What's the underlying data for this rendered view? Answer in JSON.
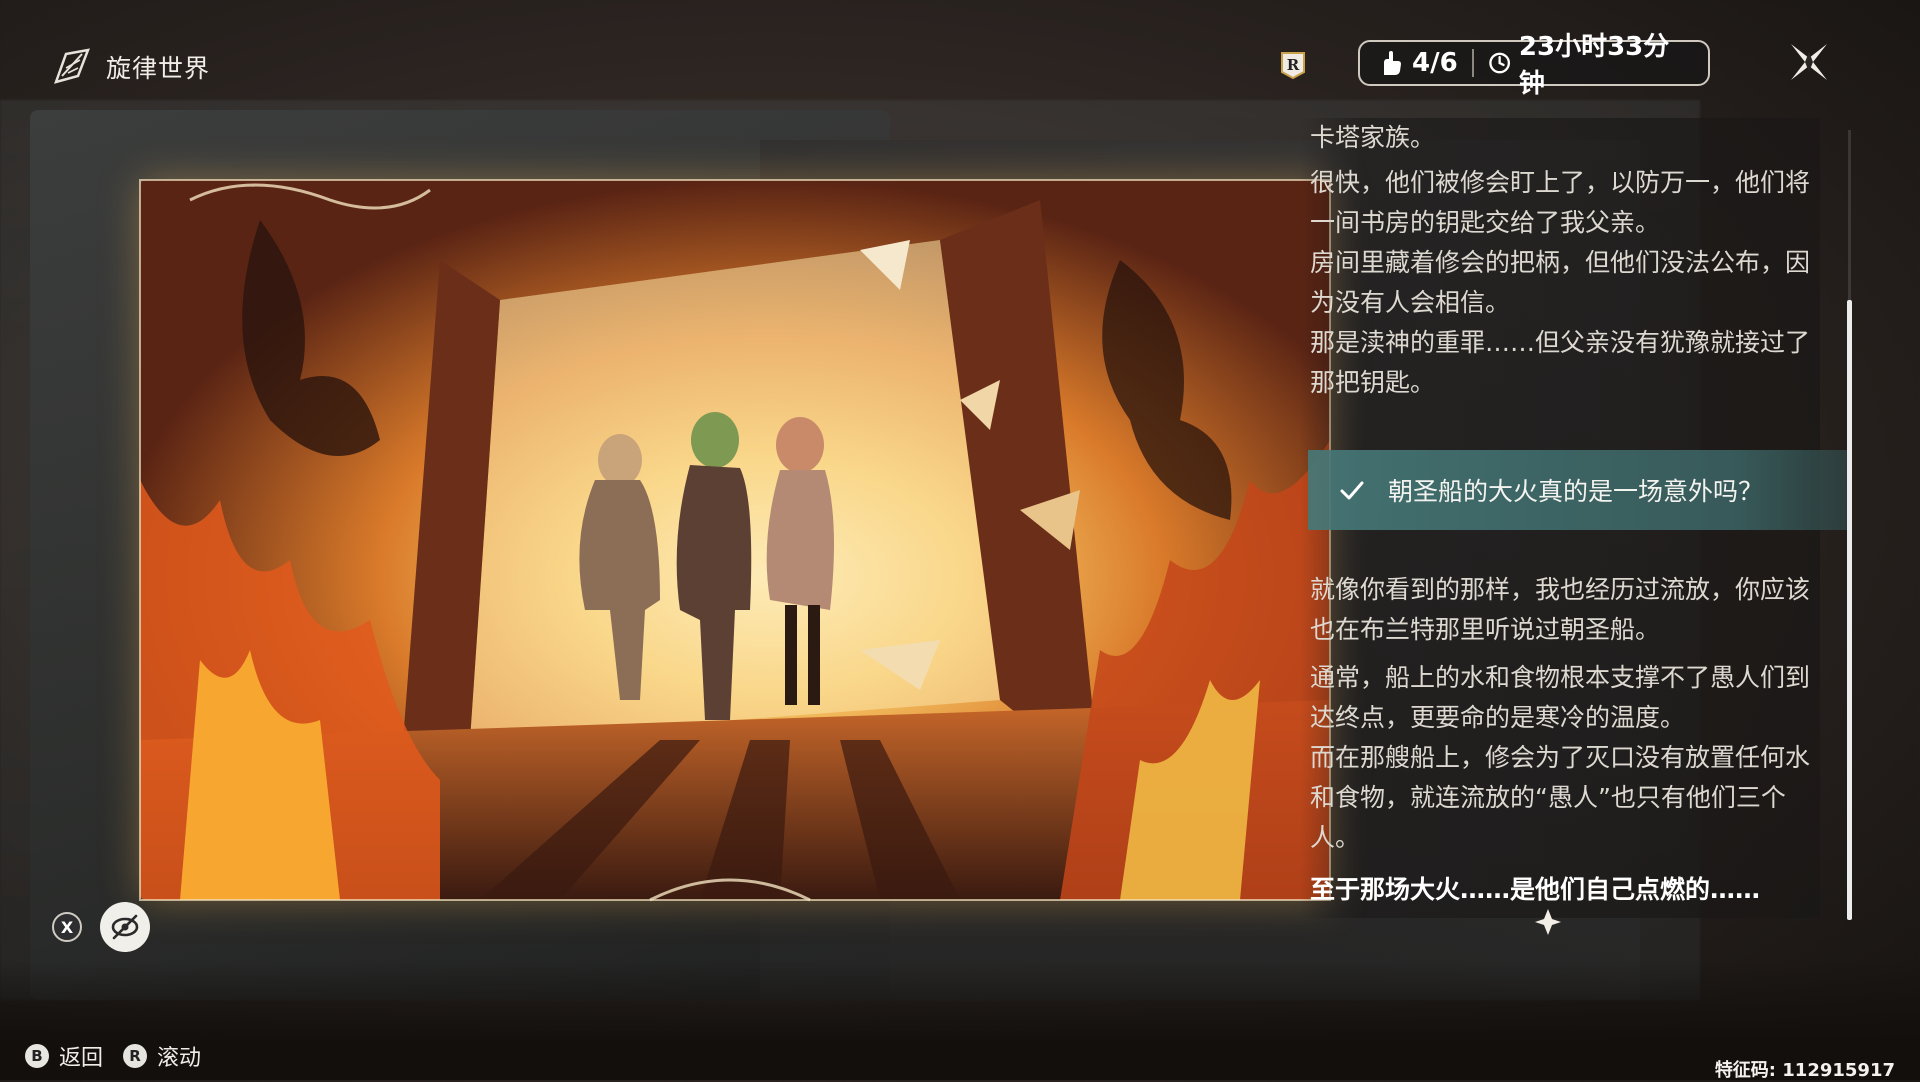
{
  "header": {
    "title": "旋律世界",
    "counter": "4/6",
    "timer": "23小时33分钟",
    "r_badge": "R"
  },
  "story": {
    "paragraphs_top": [
      "卡塔家族。",
      "很快，他们被修会盯上了，以防万一，他们将一间书房的钥匙交给了我父亲。\n房间里藏着修会的把柄，但他们没法公布，因为没有人会相信。\n那是渎神的重罪……但父亲没有犹豫就接过了那把钥匙。"
    ],
    "choice": "朝圣船的大火真的是一场意外吗？",
    "paragraphs_bottom": [
      "就像你看到的那样，我也经历过流放，你应该也在布兰特那里听说过朝圣船。",
      "通常，船上的水和食物根本支撑不了愚人们到达终点，更要命的是寒冷的温度。\n而在那艘船上，修会为了灭口没有放置任何水和食物，就连流放的“愚人”也只有他们三个人。",
      "至于那场大火……是他们自己点燃的……"
    ]
  },
  "controls": {
    "x_key": "X",
    "back_key": "B",
    "back_label": "返回",
    "scroll_key": "R",
    "scroll_label": "滚动"
  },
  "footer": {
    "feature_code": "特征码: 112915917"
  },
  "colors": {
    "choice_bg": "#4f8585",
    "accent_fire": "#f2a23a"
  }
}
